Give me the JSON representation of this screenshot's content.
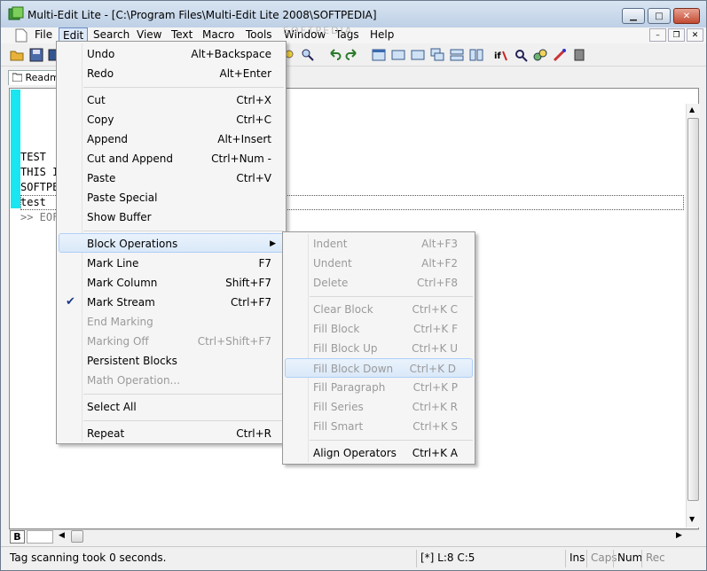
{
  "window": {
    "title": "Multi-Edit Lite - [C:\\Program Files\\Multi-Edit Lite 2008\\SOFTPEDIA]",
    "controls": {
      "minimize": "▁",
      "maximize": "□",
      "close": "✕"
    }
  },
  "menubar": {
    "items": [
      "File",
      "Edit",
      "Search",
      "View",
      "Text",
      "Macro",
      "Tools",
      "Window",
      "Tags",
      "Help"
    ],
    "watermark": "SOFTPEDIA"
  },
  "mdi_controls": {
    "minimize": "–",
    "restore": "❐",
    "close": "✕"
  },
  "tab": {
    "label": "Readme"
  },
  "editor": {
    "lines": [
      "TEST",
      "THIS I",
      "SOFTPE",
      "test",
      ">> EOF"
    ]
  },
  "edit_menu": {
    "items": [
      {
        "label": "Undo",
        "key": "Alt+Backspace"
      },
      {
        "label": "Redo",
        "key": "Alt+Enter"
      },
      {
        "label": "Cut",
        "key": "Ctrl+X"
      },
      {
        "label": "Copy",
        "key": "Ctrl+C"
      },
      {
        "label": "Append",
        "key": "Alt+Insert"
      },
      {
        "label": "Cut and Append",
        "key": "Ctrl+Num -"
      },
      {
        "label": "Paste",
        "key": "Ctrl+V"
      },
      {
        "label": "Paste Special",
        "key": ""
      },
      {
        "label": "Show Buffer",
        "key": ""
      },
      {
        "label": "Block Operations",
        "key": ""
      },
      {
        "label": "Mark Line",
        "key": "F7"
      },
      {
        "label": "Mark Column",
        "key": "Shift+F7"
      },
      {
        "label": "Mark Stream",
        "key": "Ctrl+F7"
      },
      {
        "label": "End Marking",
        "key": ""
      },
      {
        "label": "Marking Off",
        "key": "Ctrl+Shift+F7"
      },
      {
        "label": "Persistent Blocks",
        "key": ""
      },
      {
        "label": "Math Operation...",
        "key": ""
      },
      {
        "label": "Select All",
        "key": ""
      },
      {
        "label": "Repeat",
        "key": "Ctrl+R"
      }
    ],
    "check_glyph": "✔",
    "submenu_arrow": "▶"
  },
  "block_menu": {
    "items": [
      {
        "label": "Indent",
        "key": "Alt+F3"
      },
      {
        "label": "Undent",
        "key": "Alt+F2"
      },
      {
        "label": "Delete",
        "key": "Ctrl+F8"
      },
      {
        "label": "Clear Block",
        "key": "Ctrl+K C"
      },
      {
        "label": "Fill Block",
        "key": "Ctrl+K F"
      },
      {
        "label": "Fill Block Up",
        "key": "Ctrl+K U"
      },
      {
        "label": "Fill Block Down",
        "key": "Ctrl+K D"
      },
      {
        "label": "Fill Paragraph",
        "key": "Ctrl+K P"
      },
      {
        "label": "Fill Series",
        "key": "Ctrl+K R"
      },
      {
        "label": "Fill Smart",
        "key": "Ctrl+K S"
      },
      {
        "label": "Align Operators",
        "key": "Ctrl+K A"
      }
    ]
  },
  "hscroll": {
    "mode": "B",
    "left_arrow": "◀",
    "right_arrow": "▶"
  },
  "vscroll": {
    "up": "▲",
    "down": "▼"
  },
  "status": {
    "message": "Tag scanning took 0 seconds.",
    "position": "[*] L:8 C:5",
    "ins": "Ins",
    "caps": "Caps",
    "num": "Num",
    "rec": "Rec"
  }
}
